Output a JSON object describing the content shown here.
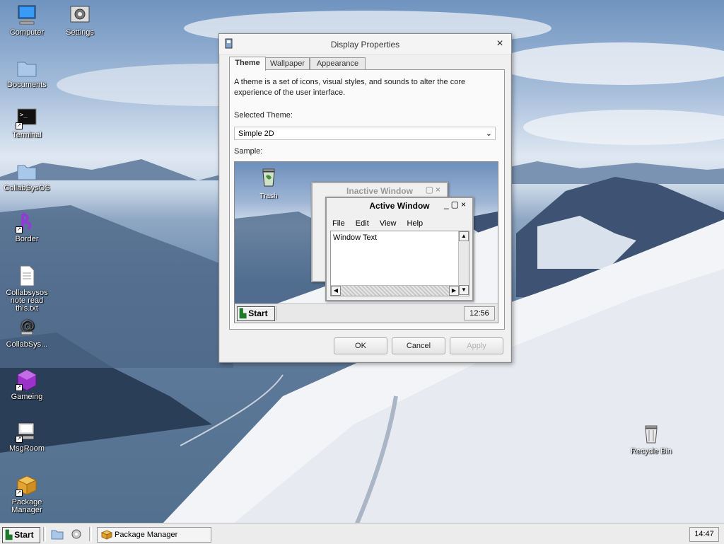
{
  "desktop": {
    "icons": [
      {
        "label": "Computer",
        "icon": "computer-icon"
      },
      {
        "label": "Settings",
        "icon": "settings-icon"
      },
      {
        "label": "Documents",
        "icon": "folder-icon"
      },
      {
        "label": "Terminal",
        "icon": "terminal-icon"
      },
      {
        "label": "CollabSysOS",
        "icon": "folder-icon"
      },
      {
        "label": "Border",
        "icon": "border-logo-icon"
      },
      {
        "label": "Collabsysos note read this.txt",
        "icon": "text-file-icon"
      },
      {
        "label": "CollabSys...",
        "icon": "at-sign-icon"
      },
      {
        "label": "Gameing",
        "icon": "game-cube-icon"
      },
      {
        "label": "MsgRoom",
        "icon": "chat-computer-icon"
      },
      {
        "label": "Package Manager",
        "icon": "package-icon"
      },
      {
        "label": "Recycle Bin",
        "icon": "trash-icon"
      }
    ]
  },
  "dialog": {
    "title": "Display Properties",
    "tabs": [
      "Theme",
      "Wallpaper",
      "Appearance"
    ],
    "active_tab": "Theme",
    "description": "A theme is a set of icons, visual styles, and sounds to alter the core experience of the user interface.",
    "selected_theme_label": "Selected Theme:",
    "selected_theme_value": "Simple 2D",
    "sample_label": "Sample:",
    "sample": {
      "trash_label": "Trash",
      "inactive_title": "Inactive Window",
      "active_title": "Active Window",
      "menu": [
        "File",
        "Edit",
        "View",
        "Help"
      ],
      "window_text": "Window Text",
      "start_label": "Start",
      "clock": "12:56"
    },
    "buttons": {
      "ok": "OK",
      "cancel": "Cancel",
      "apply": "Apply"
    }
  },
  "taskbar": {
    "start_label": "Start",
    "task_label": "Package Manager",
    "clock": "14:47"
  },
  "colors": {
    "sky": "#6f93bf",
    "snow": "#f2f4f7",
    "window_bg": "#f0f0f0"
  }
}
